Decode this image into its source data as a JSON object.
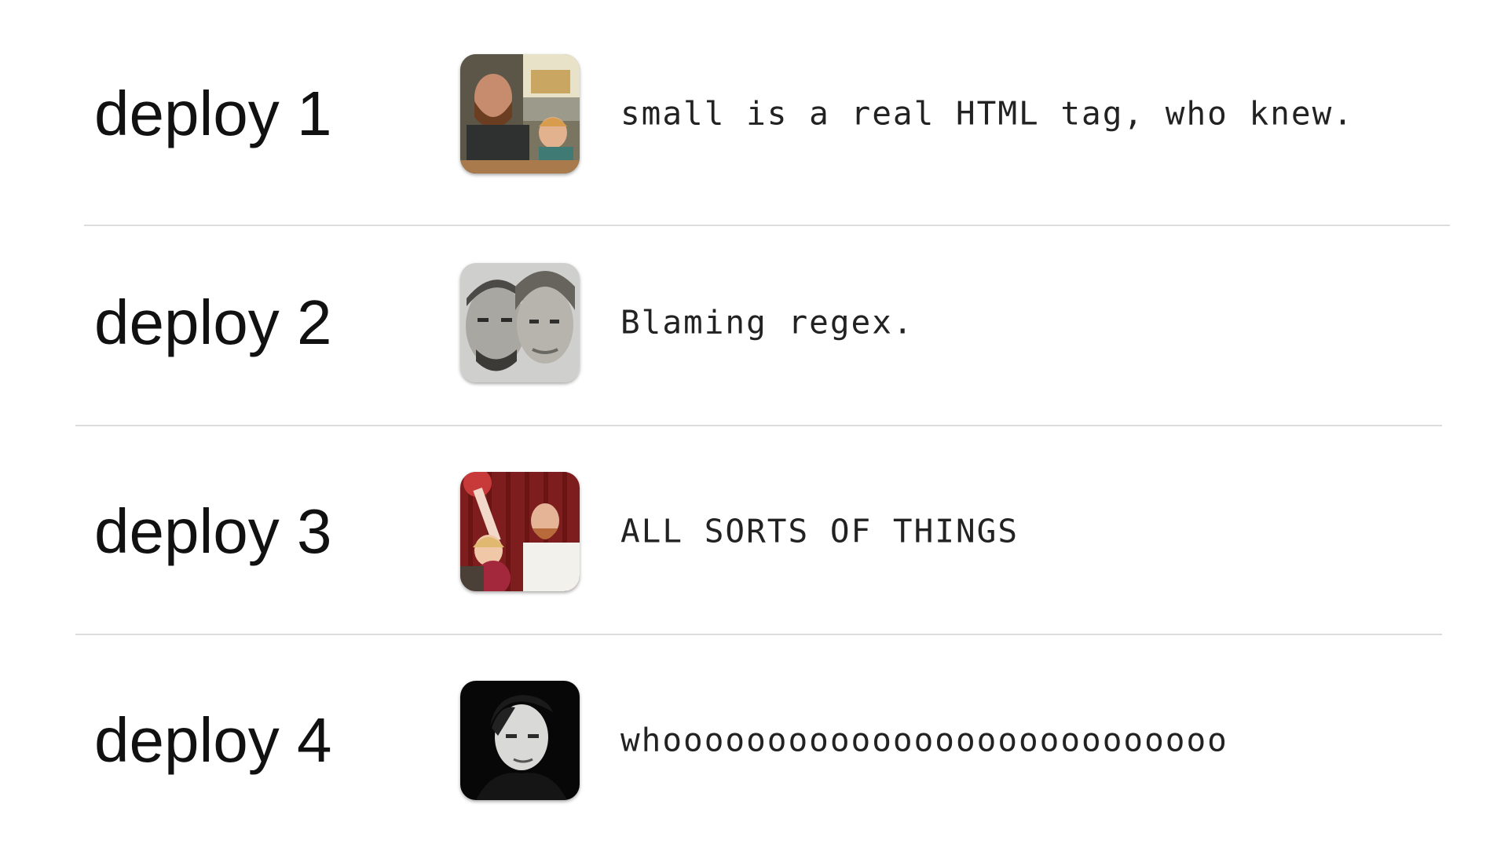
{
  "deploys": [
    {
      "label": "deploy 1",
      "message": "small is a real HTML tag, who knew.",
      "avatar_icon": "avatar-photo-man-with-child"
    },
    {
      "label": "deploy 2",
      "message": "Blaming regex.",
      "avatar_icon": "avatar-photo-couple-sepia"
    },
    {
      "label": "deploy 3",
      "message": "ALL SORTS OF THINGS",
      "avatar_icon": "avatar-photo-couple-red-curtain"
    },
    {
      "label": "deploy 4",
      "message": "whooooooooooooooooooooooooooo",
      "avatar_icon": "avatar-photo-man-dark-background"
    }
  ],
  "colors": {
    "background": "#ffffff",
    "text": "#111111",
    "divider": "#dcdcdc"
  }
}
